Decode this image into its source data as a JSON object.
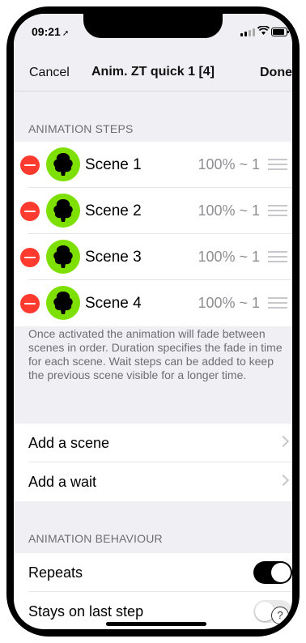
{
  "status_bar": {
    "time": "09:21",
    "location_arrow": "➚"
  },
  "nav": {
    "cancel": "Cancel",
    "title": "Anim. ZT quick 1 [4]",
    "done": "Done"
  },
  "animation_steps": {
    "header": "ANIMATION STEPS",
    "steps": [
      {
        "name": "Scene 1",
        "value": "100% ~ 1"
      },
      {
        "name": "Scene 2",
        "value": "100% ~ 1"
      },
      {
        "name": "Scene 3",
        "value": "100% ~ 1"
      },
      {
        "name": "Scene 4",
        "value": "100% ~ 1"
      }
    ],
    "footer": "Once activated the animation will fade between scenes in order. Duration specifies the fade in time for each scene. Wait steps can be added to keep the previous scene visible for a longer time."
  },
  "actions": {
    "add_scene": "Add a scene",
    "add_wait": "Add a wait"
  },
  "behaviour": {
    "header": "ANIMATION BEHAVIOUR",
    "repeats_label": "Repeats",
    "repeats_on": true,
    "stays_label": "Stays on last step",
    "stays_on": false
  },
  "help_glyph": "?",
  "colors": {
    "delete": "#ff3b30",
    "scene_icon_bg": "#7ee000",
    "toggle_on": "#000000"
  }
}
